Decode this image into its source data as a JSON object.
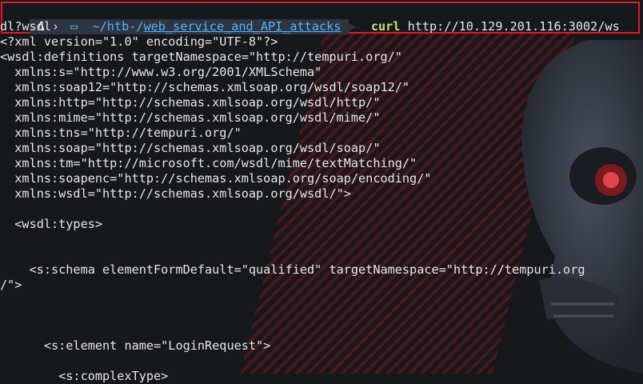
{
  "prompt": {
    "os_icon": "Δ",
    "dir_icon": "folder-icon",
    "path_prefix": "~/htb-/",
    "path_dir": "web_service_and_API_attacks",
    "command": "curl",
    "args_line1": "http://10.129.201.116:3002/ws",
    "args_line2": "dl?wsdl"
  },
  "output": [
    "<?xml version=\"1.0\" encoding=\"UTF-8\"?>",
    "<wsdl:definitions targetNamespace=\"http://tempuri.org/\"",
    "  xmlns:s=\"http://www.w3.org/2001/XMLSchema\"",
    "  xmlns:soap12=\"http://schemas.xmlsoap.org/wsdl/soap12/\"",
    "  xmlns:http=\"http://schemas.xmlsoap.org/wsdl/http/\"",
    "  xmlns:mime=\"http://schemas.xmlsoap.org/wsdl/mime/\"",
    "  xmlns:tns=\"http://tempuri.org/\"",
    "  xmlns:soap=\"http://schemas.xmlsoap.org/wsdl/soap/\"",
    "  xmlns:tm=\"http://microsoft.com/wsdl/mime/textMatching/\"",
    "  xmlns:soapenc=\"http://schemas.xmlsoap.org/soap/encoding/\"",
    "  xmlns:wsdl=\"http://schemas.xmlsoap.org/wsdl/\">",
    "",
    "  <wsdl:types>",
    "",
    "",
    "    <s:schema elementFormDefault=\"qualified\" targetNamespace=\"http://tempuri.org",
    "/\">",
    "",
    "",
    "",
    "      <s:element name=\"LoginRequest\">",
    "",
    "        <s:complexType>"
  ],
  "colors": {
    "accent_border": "#e01b24",
    "command": "#c4e36a",
    "path": "#52b4ff",
    "background": "#16181c"
  }
}
